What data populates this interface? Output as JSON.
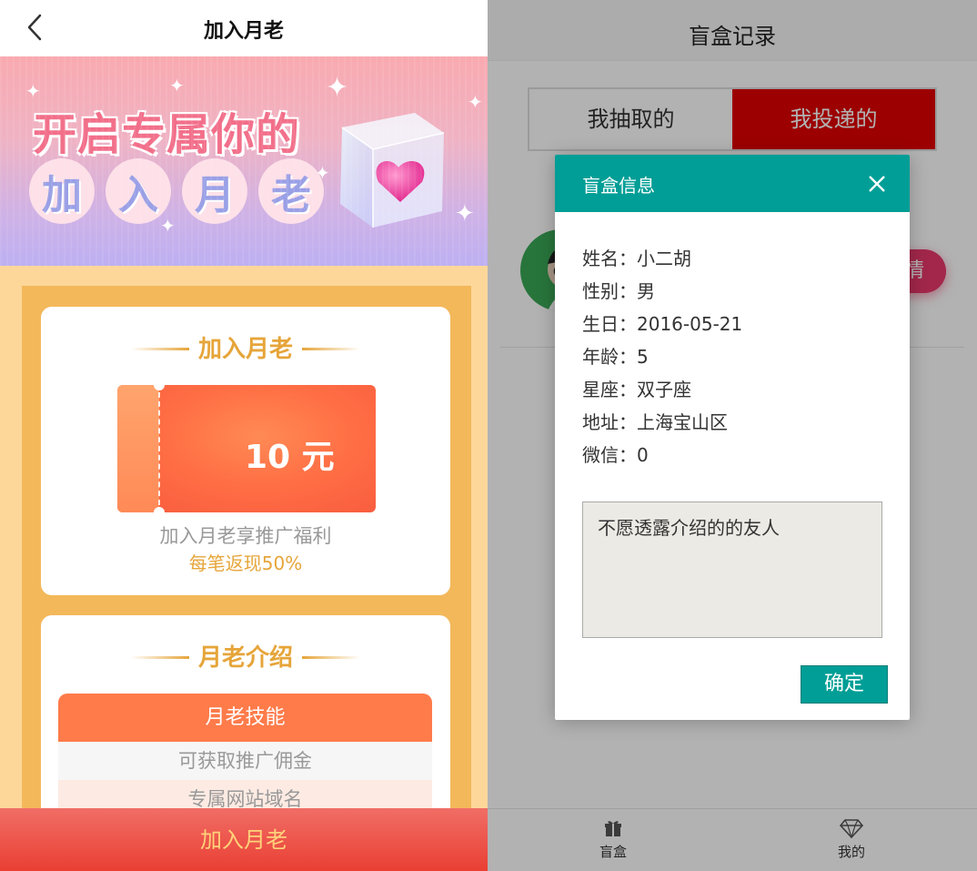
{
  "left": {
    "header": {
      "title": "加入月老"
    },
    "banner": {
      "line1": "开启专属你的",
      "line2_chars": [
        "加",
        "入",
        "月",
        "老"
      ]
    },
    "card1": {
      "title": "加入月老",
      "coupon_value": "10 元",
      "desc": "加入月老享推广福利",
      "sub": "每笔返现50%"
    },
    "card2": {
      "title": "月老介绍",
      "table_header": "月老技能",
      "rows": [
        "可获取推广佣金",
        "专属网站域名"
      ]
    },
    "join_button": "加入月老"
  },
  "right": {
    "header": {
      "title": "盲盒记录"
    },
    "tabs": [
      {
        "label": "我抽取的",
        "active": false
      },
      {
        "label": "我投递的",
        "active": true
      }
    ],
    "detail_button": "详情",
    "tabbar": [
      {
        "label": "盲盒",
        "icon": "gift-icon"
      },
      {
        "label": "我的",
        "icon": "diamond-icon"
      }
    ],
    "modal": {
      "title": "盲盒信息",
      "fields": [
        {
          "label": "姓名：",
          "value": "小二胡"
        },
        {
          "label": "性别：",
          "value": "男"
        },
        {
          "label": "生日：",
          "value": "2016-05-21"
        },
        {
          "label": "年龄：",
          "value": "5"
        },
        {
          "label": "星座：",
          "value": "双子座"
        },
        {
          "label": "地址：",
          "value": "上海宝山区"
        },
        {
          "label": "微信：",
          "value": "0"
        }
      ],
      "note": "不愿透露介绍的的友人",
      "confirm": "确定"
    }
  },
  "colors": {
    "accent_gold": "#e6a53a",
    "coupon_orange": "#ff6f45",
    "tab_active_red": "#e00000",
    "modal_teal": "#009e96",
    "join_button_red": "#ea3f33"
  }
}
